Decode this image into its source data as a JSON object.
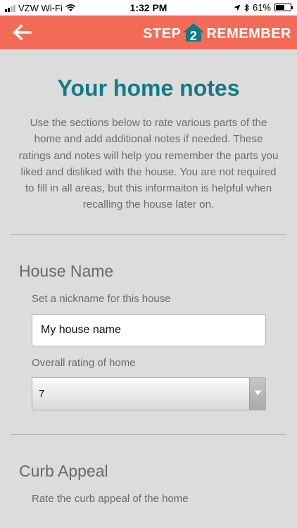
{
  "status_bar": {
    "carrier": "VZW Wi-Fi",
    "time": "1:32 PM",
    "battery_percent": "61%",
    "battery_level": 0.61,
    "icons": [
      "wifi-icon",
      "location-arrow-icon",
      "bluetooth-icon",
      "battery-icon"
    ]
  },
  "app_bar": {
    "background": "#f36b57",
    "back_icon": "back-arrow-icon",
    "logo": {
      "left": "STEP",
      "number": "2",
      "right": "REMEMBER"
    }
  },
  "page": {
    "title": "Your home notes",
    "intro": "Use the sections below to rate various parts of the home and add additional notes if needed. These ratings and notes will help you remember the parts you liked and disliked with the house. You are not required to fill in all areas, but this informaiton is helpful when recalling the house later on."
  },
  "sections": {
    "house_name": {
      "title": "House Name",
      "nickname_label": "Set a nickname for this house",
      "nickname_value": "My house name",
      "rating_label": "Overall rating of home",
      "rating_value": "7"
    },
    "curb_appeal": {
      "title": "Curb Appeal",
      "rating_label": "Rate the curb appeal of the home"
    }
  },
  "colors": {
    "accent": "#f36b57",
    "title": "#137a83",
    "background": "#dcdcdc"
  }
}
